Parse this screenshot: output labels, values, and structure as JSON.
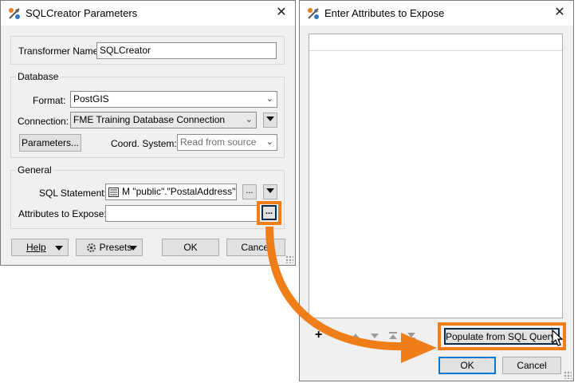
{
  "params_dialog": {
    "title": "SQLCreator Parameters",
    "transformer_name_label": "Transformer Name:",
    "transformer_name_value": "SQLCreator",
    "database_group": "Database",
    "format_label": "Format:",
    "format_value": "PostGIS",
    "connection_label": "Connection:",
    "connection_value": "FME Training Database Connection",
    "parameters_button": "Parameters...",
    "coord_system_label": "Coord. System:",
    "coord_system_value": "Read from source",
    "general_group": "General",
    "sql_statement_label": "SQL Statement:",
    "sql_statement_value": "M \"public\".\"PostalAddress\" ...",
    "attributes_label": "Attributes to Expose:",
    "attributes_value": "",
    "ellipsis": "...",
    "help_button": "Help",
    "presets_button": "Presets",
    "ok_button": "OK",
    "cancel_button": "Cancel"
  },
  "expose_dialog": {
    "title": "Enter Attributes to Expose",
    "add_symbol": "+",
    "populate_button": "Populate from SQL Query...",
    "ok_button": "OK",
    "cancel_button": "Cancel"
  },
  "colors": {
    "highlight": "#f07e18",
    "focus_blue": "#0078d7",
    "dialog_bg": "#f0f0f0"
  }
}
